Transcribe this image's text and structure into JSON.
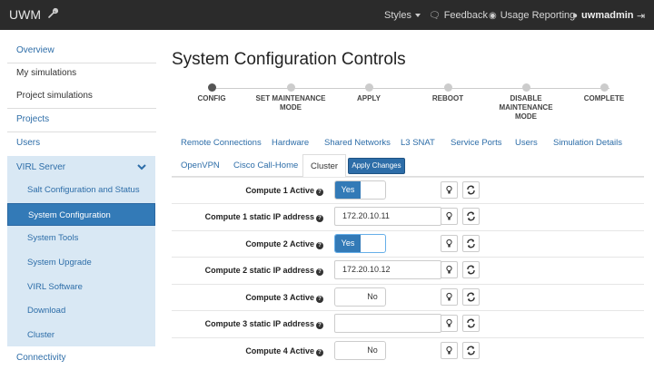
{
  "navbar": {
    "brand": "UWM",
    "styles": "Styles",
    "feedback": "Feedback",
    "usage": "Usage Reporting",
    "user": "uwmadmin"
  },
  "sidebar": {
    "items": [
      {
        "label": "Overview"
      },
      {
        "label": "My simulations"
      },
      {
        "label": "Project simulations"
      },
      {
        "label": "Projects"
      },
      {
        "label": "Users"
      }
    ],
    "group": "VIRL Server",
    "subitems": [
      {
        "label": "Salt Configuration and Status"
      },
      {
        "label": "System Configuration"
      },
      {
        "label": "System Tools"
      },
      {
        "label": "System Upgrade"
      },
      {
        "label": "VIRL Software"
      },
      {
        "label": "Download"
      },
      {
        "label": "Cluster"
      }
    ],
    "after": "Connectivity"
  },
  "main": {
    "title": "System Configuration Controls",
    "steps": [
      {
        "label": "CONFIG"
      },
      {
        "label": "SET MAINTENANCE MODE"
      },
      {
        "label": "APPLY"
      },
      {
        "label": "REBOOT"
      },
      {
        "label": "DISABLE MAINTENANCE MODE"
      },
      {
        "label": "COMPLETE"
      }
    ],
    "tabs_row1": [
      "Remote Connections",
      "Hardware",
      "Shared Networks",
      "L3 SNAT",
      "Service Ports",
      "Users",
      "Simulation Details"
    ],
    "tabs_row2": [
      "OpenVPN",
      "Cisco Call-Home",
      "Cluster"
    ],
    "apply_label": "Apply Changes",
    "rows": [
      {
        "label": "Compute 1 Active",
        "type": "toggle",
        "value": "Yes"
      },
      {
        "label": "Compute 1 static IP address",
        "type": "input",
        "value": "172.20.10.11"
      },
      {
        "label": "Compute 2 Active",
        "type": "toggle",
        "value": "Yes"
      },
      {
        "label": "Compute 2 static IP address",
        "type": "input",
        "value": "172.20.10.12"
      },
      {
        "label": "Compute 3 Active",
        "type": "toggle",
        "value": "No"
      },
      {
        "label": "Compute 3 static IP address",
        "type": "input",
        "value": ""
      },
      {
        "label": "Compute 4 Active",
        "type": "toggle",
        "value": "No"
      }
    ]
  },
  "colors": {
    "accent": "#337ab7",
    "navbar": "#2b2b2b",
    "sidebar_group": "#d9e8f4"
  }
}
